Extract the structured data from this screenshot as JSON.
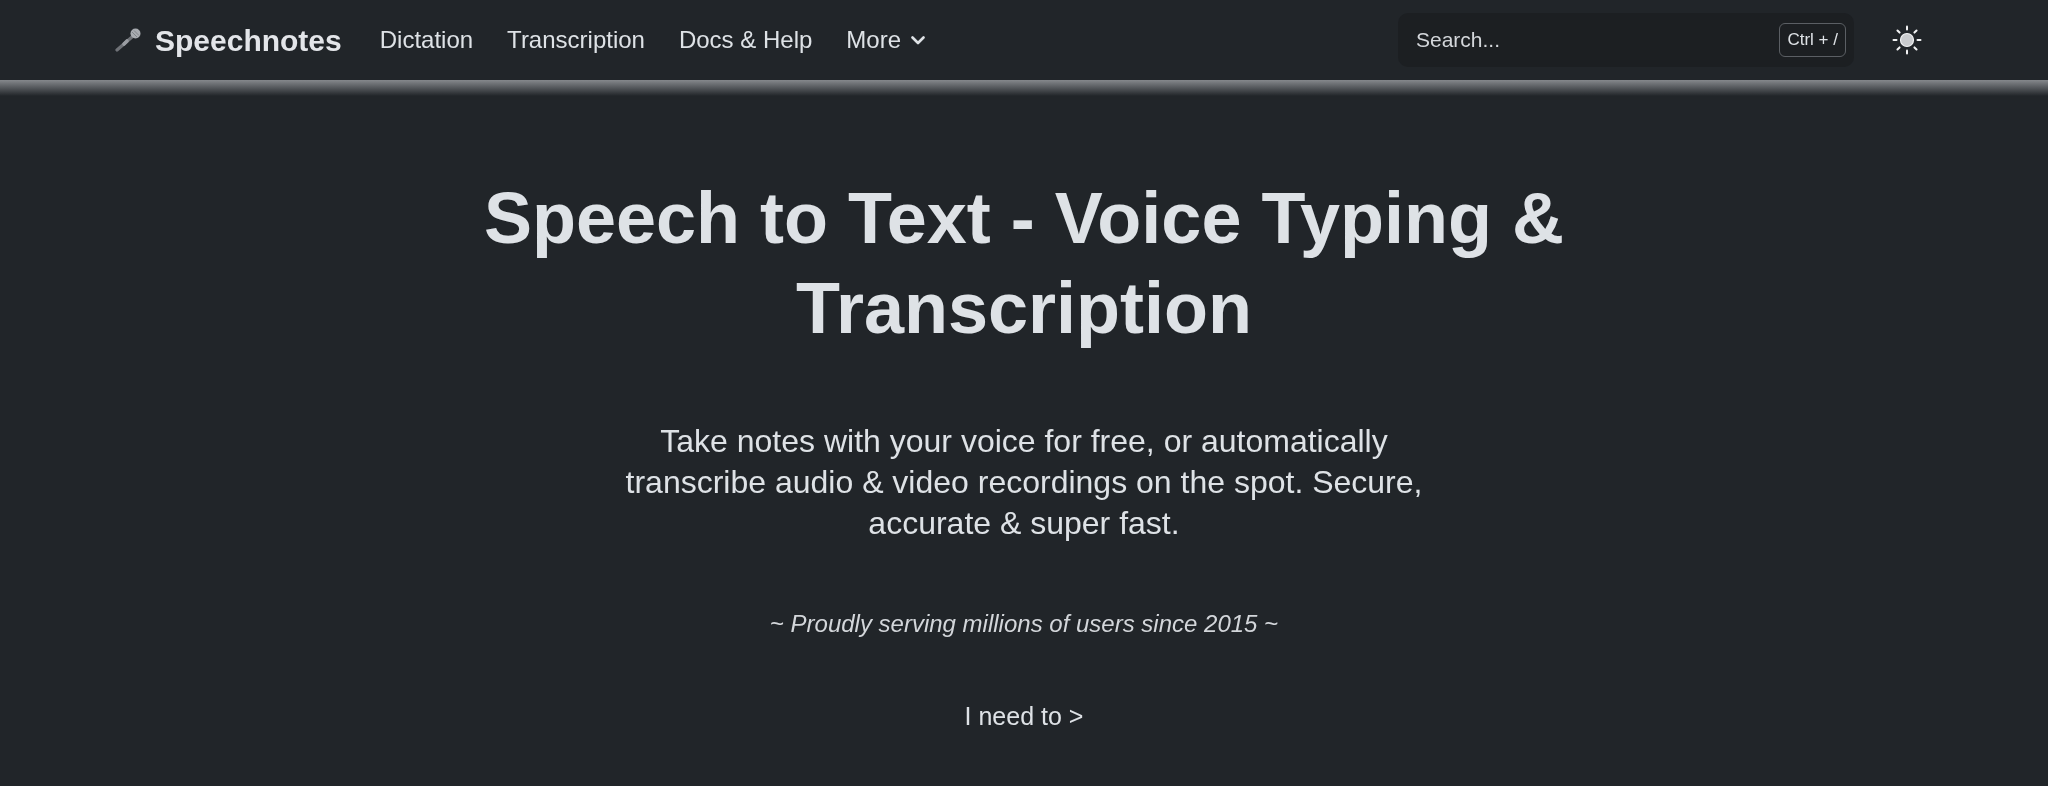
{
  "navbar": {
    "logo": "Speechnotes",
    "links": [
      {
        "label": "Dictation",
        "kind": "link"
      },
      {
        "label": "Transcription",
        "kind": "link"
      },
      {
        "label": "Docs & Help",
        "kind": "link"
      },
      {
        "label": "More",
        "kind": "dropdown"
      }
    ],
    "search": {
      "placeholder": "Search...",
      "shortcut": "Ctrl + /"
    }
  },
  "hero": {
    "title": "Speech to Text - Voice Typing & Transcription",
    "subtitle": "Take notes with your voice for free, or automatically transcribe audio & video recordings on the spot. Secure, accurate & super fast.",
    "tagline": "~ Proudly serving millions of users since 2015 ~",
    "action": "I need to >"
  }
}
